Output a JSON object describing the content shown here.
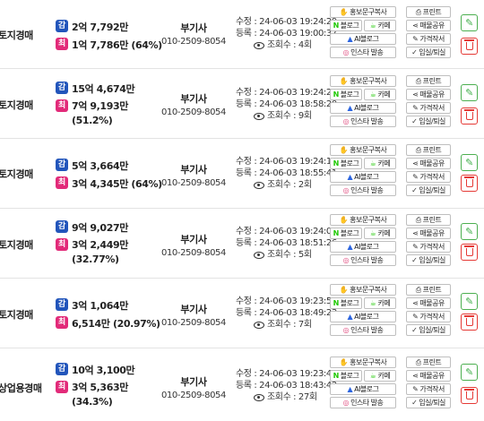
{
  "rows": [
    {
      "type": "토지경매",
      "appraisal_chip": "감",
      "appraisal": "2억 7,792만",
      "minimum_chip": "최",
      "minimum": "1억 7,786만 (64%)",
      "office": "부기사",
      "phone": "010-2509-8054",
      "modified": "수정 : 24-06-03 19:24:29",
      "registered": "등록 : 24-06-03 19:00:37",
      "views": "조회수 : 4회"
    },
    {
      "type": "토지경매",
      "appraisal_chip": "감",
      "appraisal": "15억 4,674만",
      "minimum_chip": "최",
      "minimum": "7억 9,193만 (51.2%)",
      "office": "부기사",
      "phone": "010-2509-8054",
      "modified": "수정 : 24-06-03 19:24:22",
      "registered": "등록 : 24-06-03 18:58:20",
      "views": "조회수 : 9회"
    },
    {
      "type": "토지경매",
      "appraisal_chip": "감",
      "appraisal": "5억 3,664만",
      "minimum_chip": "최",
      "minimum": "3억 4,345만 (64%)",
      "office": "부기사",
      "phone": "010-2509-8054",
      "modified": "수정 : 24-06-03 19:24:14",
      "registered": "등록 : 24-06-03 18:55:41",
      "views": "조회수 : 2회"
    },
    {
      "type": "토지경매",
      "appraisal_chip": "감",
      "appraisal": "9억 9,027만",
      "minimum_chip": "최",
      "minimum": "3억 2,449만 (32.77%)",
      "office": "부기사",
      "phone": "010-2509-8054",
      "modified": "수정 : 24-06-03 19:24:07",
      "registered": "등록 : 24-06-03 18:51:26",
      "views": "조회수 : 5회"
    },
    {
      "type": "토지경매",
      "appraisal_chip": "감",
      "appraisal": "3억 1,064만",
      "minimum_chip": "최",
      "minimum": "6,514만 (20.97%)",
      "office": "부기사",
      "phone": "010-2509-8054",
      "modified": "수정 : 24-06-03 19:23:57",
      "registered": "등록 : 24-06-03 18:49:23",
      "views": "조회수 : 7회"
    },
    {
      "type": "상업용경매",
      "appraisal_chip": "감",
      "appraisal": "10억 3,100만",
      "minimum_chip": "최",
      "minimum": "3억 5,363만 (34.3%)",
      "office": "부기사",
      "phone": "010-2509-8054",
      "modified": "수정 : 24-06-03 19:23:49",
      "registered": "등록 : 24-06-03 18:43:42",
      "views": "조회수 : 27회"
    }
  ],
  "actions": {
    "promo_copy": "홍보문구복사",
    "blog": "블로그",
    "cafe": "카페",
    "ai_blog": "AI블로그",
    "instagram": "인스타 발송",
    "print": "프린트",
    "share": "매물공유",
    "write_price": "가격작서",
    "move_in_out": "입실/퇴실"
  },
  "icons": {
    "promo_copy": "hand-copy-icon",
    "blog": "naver-n-icon",
    "cafe": "cafe-icon",
    "ai_blog": "ai-blog-icon",
    "instagram": "instagram-icon",
    "print": "printer-icon",
    "share": "share-icon",
    "write_price": "edit-icon",
    "move_in_out": "double-check-icon",
    "edit": "pencil-icon",
    "delete": "trash-icon",
    "views": "eye-icon"
  },
  "colors": {
    "appraisal_chip": "#2255bb",
    "minimum_chip": "#e22a79",
    "edit": "#3fae49",
    "delete": "#e53935",
    "naver_green": "#1ec800"
  }
}
